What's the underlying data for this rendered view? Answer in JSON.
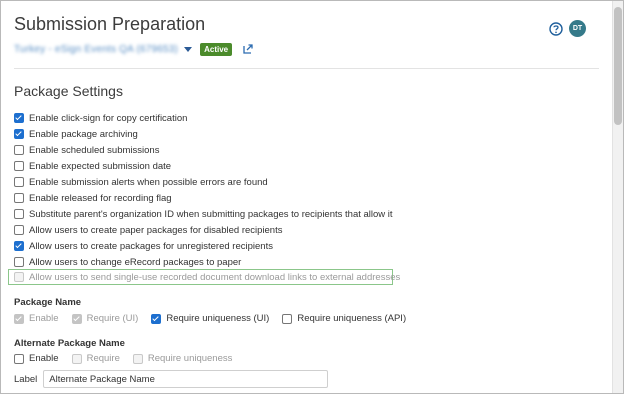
{
  "header": {
    "title": "Submission Preparation",
    "org_name": "Turkey - eSign Events QA (679653)",
    "status_badge": "Active",
    "avatar_initials": "DT"
  },
  "package_settings": {
    "title": "Package Settings",
    "options": [
      {
        "label": "Enable click-sign for copy certification",
        "checked": true
      },
      {
        "label": "Enable package archiving",
        "checked": true
      },
      {
        "label": "Enable scheduled submissions",
        "checked": false
      },
      {
        "label": "Enable expected submission date",
        "checked": false
      },
      {
        "label": "Enable submission alerts when possible errors are found",
        "checked": false
      },
      {
        "label": "Enable released for recording flag",
        "checked": false
      },
      {
        "label": "Substitute parent's organization ID when submitting packages to recipients that allow it",
        "checked": false
      },
      {
        "label": "Allow users to create paper packages for disabled recipients",
        "checked": false
      },
      {
        "label": "Allow users to create packages for unregistered recipients",
        "checked": true
      },
      {
        "label": "Allow users to change eRecord packages to paper",
        "checked": false
      }
    ],
    "highlighted_option": {
      "label": "Allow users to send single-use recorded document download links to external addresses",
      "checked": false,
      "disabled": true
    }
  },
  "package_name": {
    "title": "Package Name",
    "enable_label": "Enable",
    "require_ui_label": "Require (UI)",
    "uniqueness_ui_label": "Require uniqueness (UI)",
    "uniqueness_api_label": "Require uniqueness (API)"
  },
  "alternate_package_name": {
    "title": "Alternate Package Name",
    "enable_label": "Enable",
    "require_label": "Require",
    "uniqueness_label": "Require uniqueness",
    "label_text": "Label",
    "label_value": "Alternate Package Name"
  },
  "colors": {
    "accent": "#1d6fcf",
    "badge": "#4b8b2b",
    "highlight_border": "#8bc68a",
    "avatar": "#357a8a"
  },
  "icons": {
    "help": "help-circle-icon",
    "share": "share-icon",
    "caret": "chevron-down-icon"
  }
}
